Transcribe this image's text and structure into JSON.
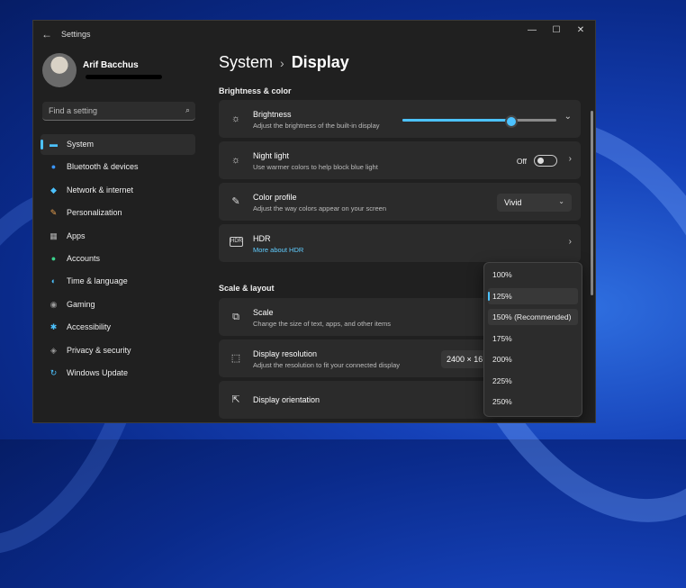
{
  "window": {
    "title": "Settings",
    "back": "←",
    "minimize": "—",
    "maximize": "☐",
    "close": "✕"
  },
  "profile": {
    "name": "Arif Bacchus"
  },
  "search": {
    "placeholder": "Find a setting",
    "icon": "⌕"
  },
  "sidebar": {
    "items": [
      {
        "label": "System",
        "icon": "▬",
        "color": "#4cc2ff",
        "active": true
      },
      {
        "label": "Bluetooth & devices",
        "icon": "●",
        "color": "#3a96ff"
      },
      {
        "label": "Network & internet",
        "icon": "◆",
        "color": "#4cc2ff"
      },
      {
        "label": "Personalization",
        "icon": "✎",
        "color": "#e8a050"
      },
      {
        "label": "Apps",
        "icon": "▦",
        "color": "#b0b0b0"
      },
      {
        "label": "Accounts",
        "icon": "●",
        "color": "#3ad18c"
      },
      {
        "label": "Time & language",
        "icon": "◐",
        "color": "#4cc2ff"
      },
      {
        "label": "Gaming",
        "icon": "◉",
        "color": "#9a9a9a"
      },
      {
        "label": "Accessibility",
        "icon": "✱",
        "color": "#4cc2ff"
      },
      {
        "label": "Privacy & security",
        "icon": "◈",
        "color": "#9a9a9a"
      },
      {
        "label": "Windows Update",
        "icon": "↻",
        "color": "#4cc2ff"
      }
    ]
  },
  "breadcrumb": {
    "parent": "System",
    "separator": "›",
    "current": "Display"
  },
  "brightness_color": {
    "heading": "Brightness & color",
    "brightness": {
      "title": "Brightness",
      "subtitle": "Adjust the brightness of the built-in display",
      "icon": "☼",
      "chevron": "⌄",
      "value_fraction": 0.71
    },
    "night_light": {
      "title": "Night light",
      "subtitle": "Use warmer colors to help block blue light",
      "icon": "☼",
      "state": "Off",
      "chevron": "›"
    },
    "color_profile": {
      "title": "Color profile",
      "subtitle": "Adjust the way colors appear on your screen",
      "icon": "✎",
      "value": "Vivid",
      "chevron": "⌄"
    },
    "hdr": {
      "title": "HDR",
      "link": "More about HDR",
      "icon": "HDR",
      "chevron": "›"
    }
  },
  "scale_layout": {
    "heading": "Scale & layout",
    "scale": {
      "title": "Scale",
      "subtitle": "Change the size of text, apps, and other items",
      "icon": "⧉"
    },
    "resolution": {
      "title": "Display resolution",
      "subtitle": "Adjust the resolution to fit your connected display",
      "icon": "⬚",
      "value": "2400 × 16"
    },
    "orientation": {
      "title": "Display orientation",
      "icon": "⇱"
    }
  },
  "scale_dropdown": {
    "options": [
      "100%",
      "125%",
      "150% (Recommended)",
      "175%",
      "200%",
      "225%",
      "250%"
    ],
    "selected": "125%",
    "highlighted": "150% (Recommended)"
  },
  "colors": {
    "accent": "#4cc2ff",
    "window_bg": "#202020",
    "card_bg": "#2b2b2b"
  }
}
